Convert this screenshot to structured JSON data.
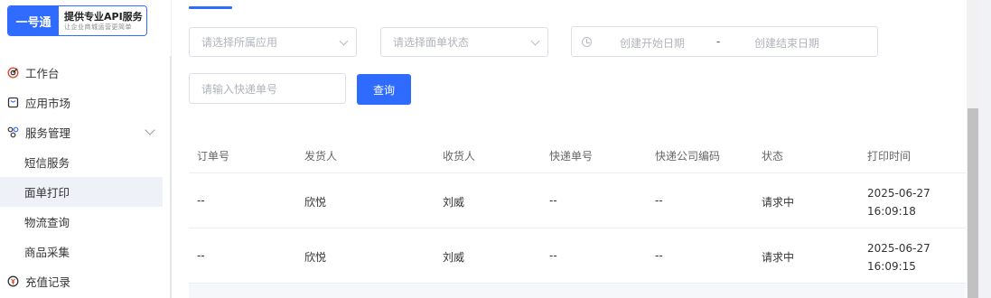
{
  "brand": {
    "logo_text": "一号通",
    "tagline": "提供专业API服务",
    "slogan": "让企业商城运营更简单",
    "color": "#2f6bff"
  },
  "sidebar": {
    "items": [
      {
        "label": "工作台",
        "icon": "dashboard-target-icon"
      },
      {
        "label": "应用市场",
        "icon": "shopping-bag-icon"
      },
      {
        "label": "服务管理",
        "icon": "cluster-icon",
        "expanded": true
      },
      {
        "label": "短信服务"
      },
      {
        "label": "面单打印",
        "active": true
      },
      {
        "label": "物流查询"
      },
      {
        "label": "商品采集"
      },
      {
        "label": "充值记录",
        "icon": "yuan-coin-icon"
      }
    ]
  },
  "filters": {
    "app_placeholder": "请选择所属应用",
    "status_placeholder": "请选择面单状态",
    "start_date_placeholder": "创建开始日期",
    "date_separator": "-",
    "end_date_placeholder": "创建结束日期",
    "tracking_placeholder": "请输入快递单号",
    "query_label": "查询"
  },
  "table": {
    "columns": [
      "订单号",
      "发货人",
      "收货人",
      "快递单号",
      "快递公司编码",
      "状态",
      "打印时间"
    ],
    "rows": [
      [
        "--",
        "欣悦",
        "刘威",
        "--",
        "--",
        "请求中",
        "2025-06-27 16:09:18"
      ],
      [
        "--",
        "欣悦",
        "刘威",
        "--",
        "--",
        "请求中",
        "2025-06-27 16:09:15"
      ]
    ]
  }
}
